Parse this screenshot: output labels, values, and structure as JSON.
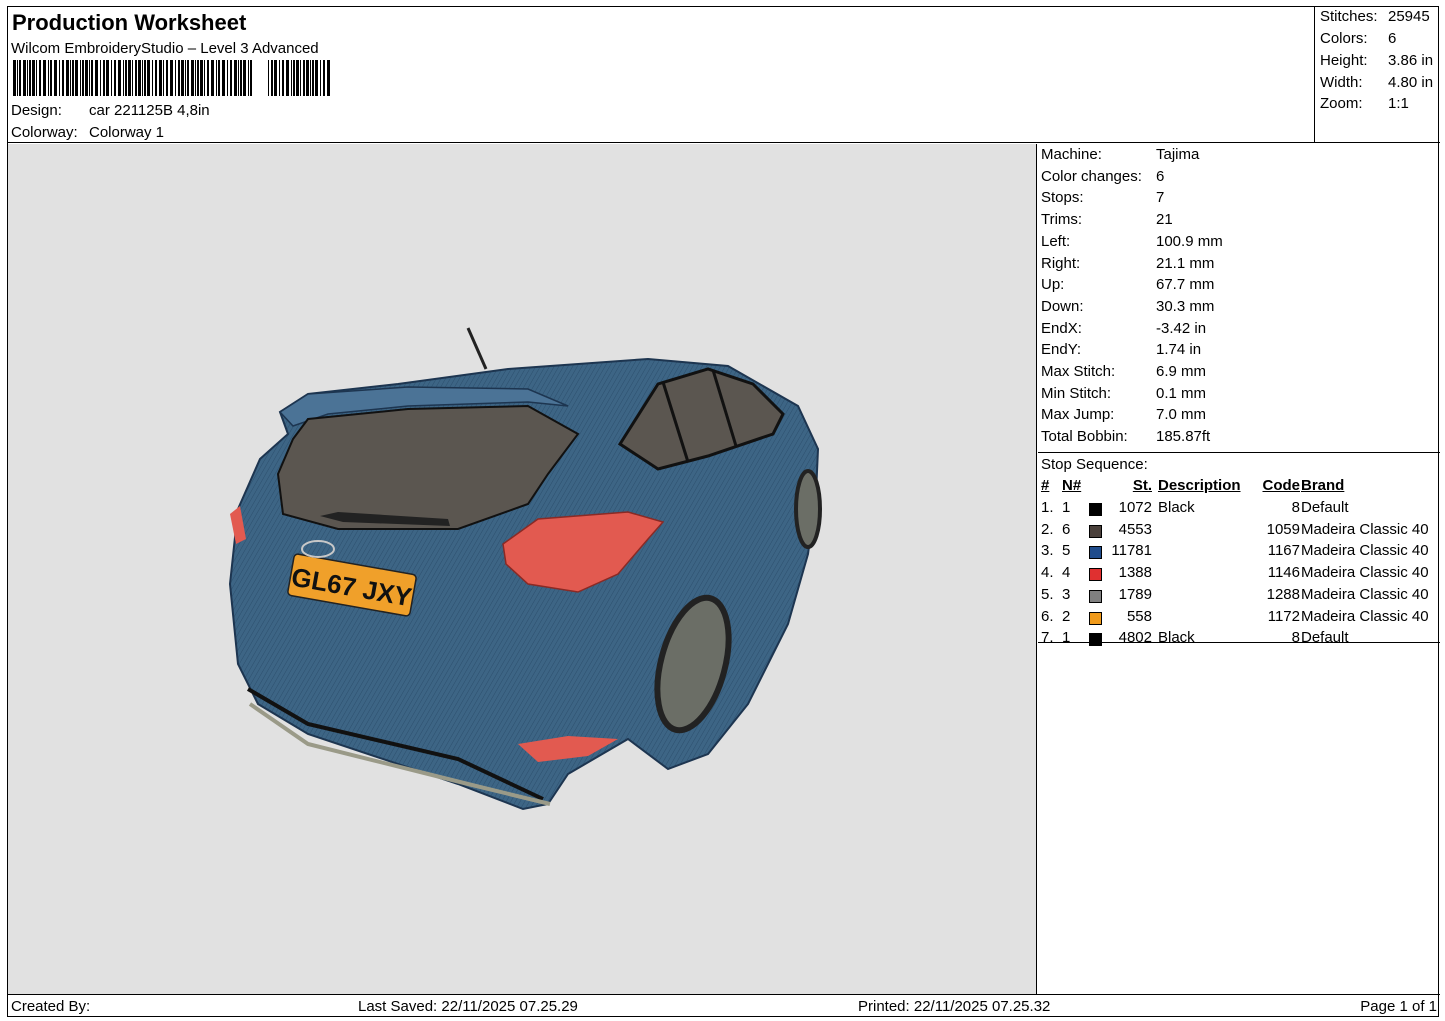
{
  "header": {
    "title": "Production Worksheet",
    "software": "Wilcom EmbroideryStudio – Level 3 Advanced",
    "design_label": "Design:",
    "design_value": "car 221125B 4,8in",
    "colorway_label": "Colorway:",
    "colorway_value": "Colorway 1"
  },
  "summary": [
    {
      "label": "Stitches:",
      "value": "25945"
    },
    {
      "label": "Colors:",
      "value": "6"
    },
    {
      "label": "Height:",
      "value": "3.86 in"
    },
    {
      "label": "Width:",
      "value": "4.80 in"
    },
    {
      "label": "Zoom:",
      "value": "1:1"
    }
  ],
  "info": [
    {
      "label": "Machine:",
      "value": "Tajima"
    },
    {
      "label": "Color changes:",
      "value": "6"
    },
    {
      "label": "Stops:",
      "value": "7"
    },
    {
      "label": "Trims:",
      "value": "21"
    },
    {
      "label": "Left:",
      "value": "100.9 mm"
    },
    {
      "label": "Right:",
      "value": "21.1 mm"
    },
    {
      "label": "Up:",
      "value": "67.7 mm"
    },
    {
      "label": "Down:",
      "value": "30.3 mm"
    },
    {
      "label": "EndX:",
      "value": "-3.42 in"
    },
    {
      "label": "EndY:",
      "value": "1.74 in"
    },
    {
      "label": "Max Stitch:",
      "value": "6.9 mm"
    },
    {
      "label": "Min Stitch:",
      "value": "0.1 mm"
    },
    {
      "label": "Max Jump:",
      "value": "7.0 mm"
    },
    {
      "label": "Total Bobbin:",
      "value": "185.87ft"
    }
  ],
  "stop_sequence": {
    "title": "Stop Sequence:",
    "headers": {
      "num": "#",
      "n": "N#",
      "st": "St.",
      "desc": "Description",
      "code": "Code",
      "brand": "Brand"
    },
    "rows": [
      {
        "num": "1.",
        "n": "1",
        "color": "#000000",
        "st": "1072",
        "desc": "Black",
        "code": "8",
        "brand": "Default"
      },
      {
        "num": "2.",
        "n": "6",
        "color": "#4a403b",
        "st": "4553",
        "desc": "",
        "code": "1059",
        "brand": "Madeira Classic 40"
      },
      {
        "num": "3.",
        "n": "5",
        "color": "#1f4c8c",
        "st": "11781",
        "desc": "",
        "code": "1167",
        "brand": "Madeira Classic 40"
      },
      {
        "num": "4.",
        "n": "4",
        "color": "#e03030",
        "st": "1388",
        "desc": "",
        "code": "1146",
        "brand": "Madeira Classic 40"
      },
      {
        "num": "5.",
        "n": "3",
        "color": "#808080",
        "st": "1789",
        "desc": "",
        "code": "1288",
        "brand": "Madeira Classic 40"
      },
      {
        "num": "6.",
        "n": "2",
        "color": "#f09a1a",
        "st": "558",
        "desc": "",
        "code": "1172",
        "brand": "Madeira Classic 40"
      },
      {
        "num": "7.",
        "n": "1",
        "color": "#000000",
        "st": "4802",
        "desc": "Black",
        "code": "8",
        "brand": "Default"
      }
    ]
  },
  "design_preview": {
    "plate_text": "GL67 JXY",
    "body_color": "#3d6585",
    "window_color": "#5b5650",
    "light_color": "#e25a50",
    "plate_color": "#f0a02a",
    "background": "#e1e1e1"
  },
  "footer": {
    "created_by": "Created By:",
    "last_saved": "Last Saved: 22/11/2025 07.25.29",
    "printed": "Printed: 22/11/2025 07.25.32",
    "page": "Page 1 of 1"
  }
}
